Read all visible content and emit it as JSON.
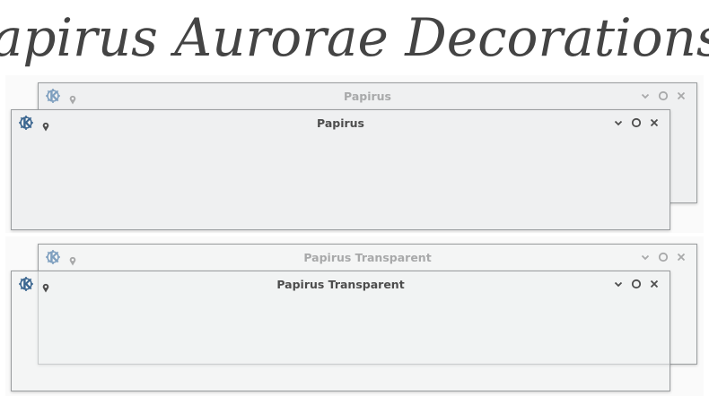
{
  "headline": "Papirus Aurorae Decorations",
  "colors": {
    "active_title": "#4d4d4d",
    "inactive_title": "#a8a9aa",
    "active_icon": "#3b6690",
    "inactive_icon": "#7e9fbf",
    "window_bg": "#eff0f1",
    "border": "#9a9d9f"
  },
  "windows": {
    "papirus_inactive": {
      "title": "Papirus",
      "state": "inactive",
      "style": "opaque"
    },
    "papirus_active": {
      "title": "Papirus",
      "state": "active",
      "style": "opaque"
    },
    "transparent_inactive": {
      "title": "Papirus Transparent",
      "state": "inactive",
      "style": "transparent"
    },
    "transparent_active": {
      "title": "Papirus Transparent",
      "state": "active",
      "style": "transparent"
    }
  },
  "icons": {
    "app": "kde-logo-icon",
    "pin": "pin-icon",
    "menu": "chevron-down-icon",
    "maximize": "circle-icon",
    "close": "close-icon"
  }
}
